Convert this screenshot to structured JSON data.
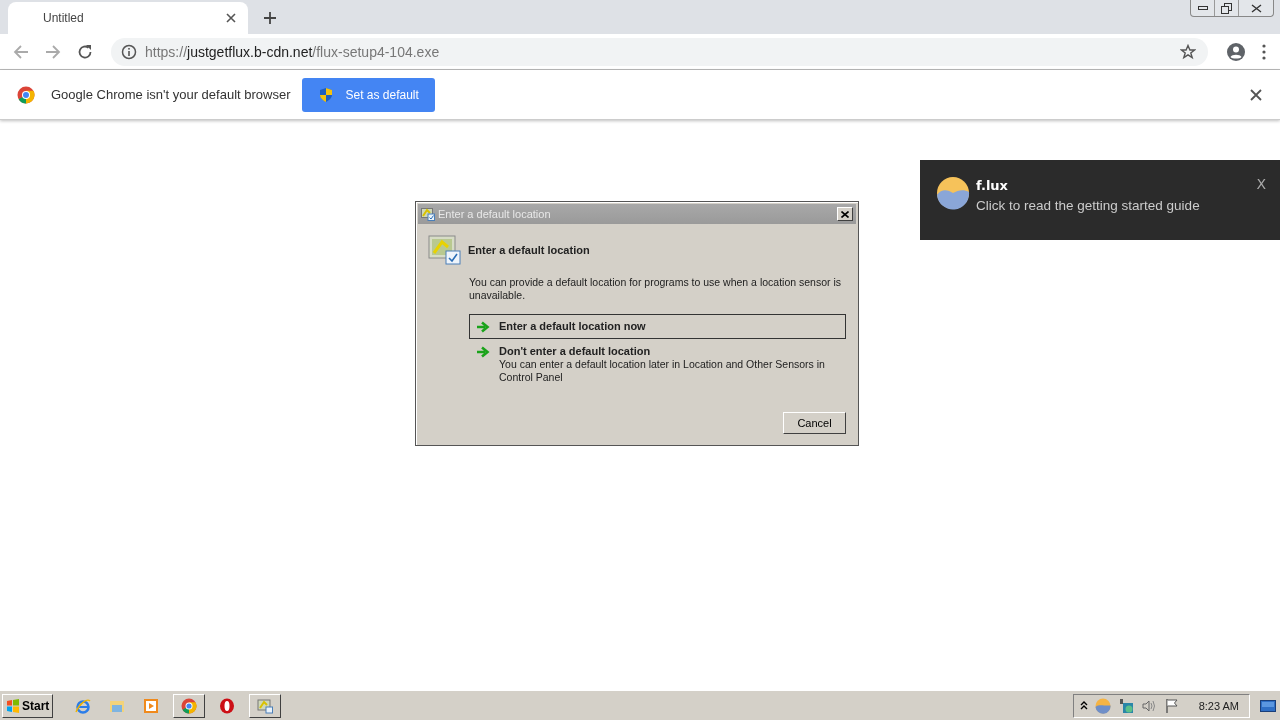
{
  "browser": {
    "tabs": [
      {
        "title": "Untitled",
        "selected": true
      }
    ],
    "url": {
      "scheme": "https://",
      "host": "justgetflux.b-cdn.net",
      "path": "/flux-setup4-104.exe"
    },
    "infobar": {
      "message": "Google Chrome isn't your default browser",
      "button": "Set as default"
    }
  },
  "dialog": {
    "title": "Enter a default location",
    "heading": "Enter a default location",
    "text": "You can provide a default location for programs to use when a location sensor is unavailable.",
    "options": [
      {
        "title": "Enter a default location now",
        "selected": true
      },
      {
        "title": "Don't enter a default location",
        "description": "You can enter a default location later in Location and Other Sensors in Control Panel",
        "selected": false
      }
    ],
    "buttons": [
      "Cancel"
    ]
  },
  "notification": {
    "app": "f.lux",
    "message": "Click to read the getting started guide",
    "close": "X"
  },
  "taskbar": {
    "start": "Start",
    "items": [
      {
        "kind": "ie",
        "selected": false
      },
      {
        "kind": "folder",
        "selected": false
      },
      {
        "kind": "media",
        "selected": false
      },
      {
        "kind": "chrome",
        "selected": true
      },
      {
        "kind": "opera",
        "selected": false
      },
      {
        "kind": "location",
        "selected": true
      }
    ],
    "tray": [
      {
        "kind": "up"
      },
      {
        "kind": "flux"
      },
      {
        "kind": "network"
      },
      {
        "kind": "volume"
      },
      {
        "kind": "flag"
      }
    ],
    "clock": "8:23 AM"
  }
}
